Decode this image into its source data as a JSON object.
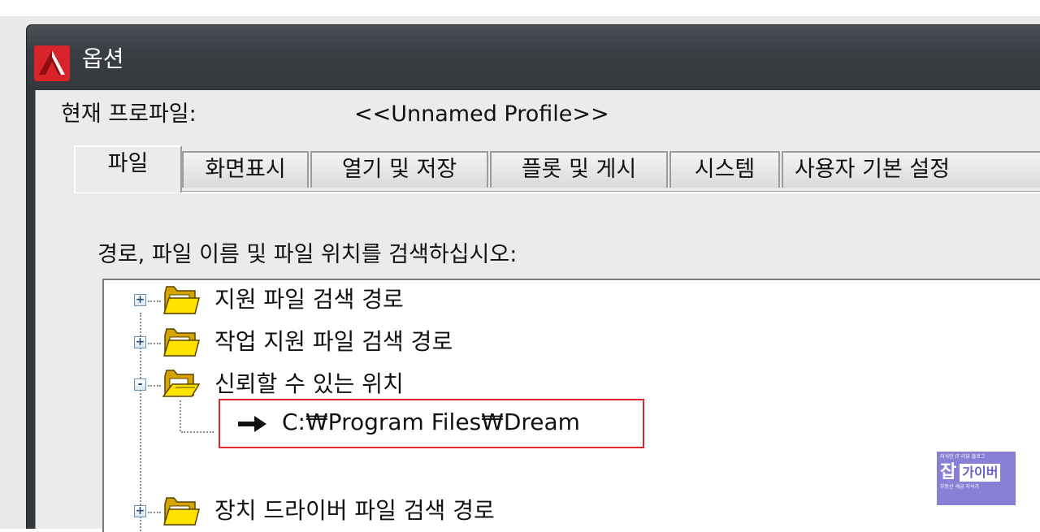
{
  "window": {
    "title": "옵션",
    "app_icon": "autocad-icon"
  },
  "profile": {
    "label": "현재 프로파일:",
    "value": "<<Unnamed Profile>>"
  },
  "tabs": [
    {
      "label": "파일",
      "active": true
    },
    {
      "label": "화면표시",
      "active": false
    },
    {
      "label": "열기 및 저장",
      "active": false
    },
    {
      "label": "플롯 및 게시",
      "active": false
    },
    {
      "label": "시스템",
      "active": false
    },
    {
      "label": "사용자 기본 설정",
      "active": false
    }
  ],
  "instruction": "경로, 파일 이름 및 파일 위치를 검색하십시오:",
  "tree": {
    "items": [
      {
        "label": "지원 파일 검색 경로",
        "expander": "+",
        "icon": "folder-icon"
      },
      {
        "label": "작업 지원 파일 검색 경로",
        "expander": "+",
        "icon": "folder-icon"
      },
      {
        "label": "신뢰할 수 있는 위치",
        "expander": "-",
        "icon": "open-folder-icon"
      },
      {
        "label": "장치 드라이버 파일 검색 경로",
        "expander": "+",
        "icon": "folder-icon"
      }
    ],
    "child_path": "C:₩Program Files₩Dream",
    "child_icon": "arrow-right-icon",
    "highlight_color": "#e0262e"
  },
  "watermark": {
    "top": "지식인 IT 리뷰 블로그",
    "jab": "잡",
    "name": "가이버",
    "bottom": "부동산 세금 지식가"
  }
}
